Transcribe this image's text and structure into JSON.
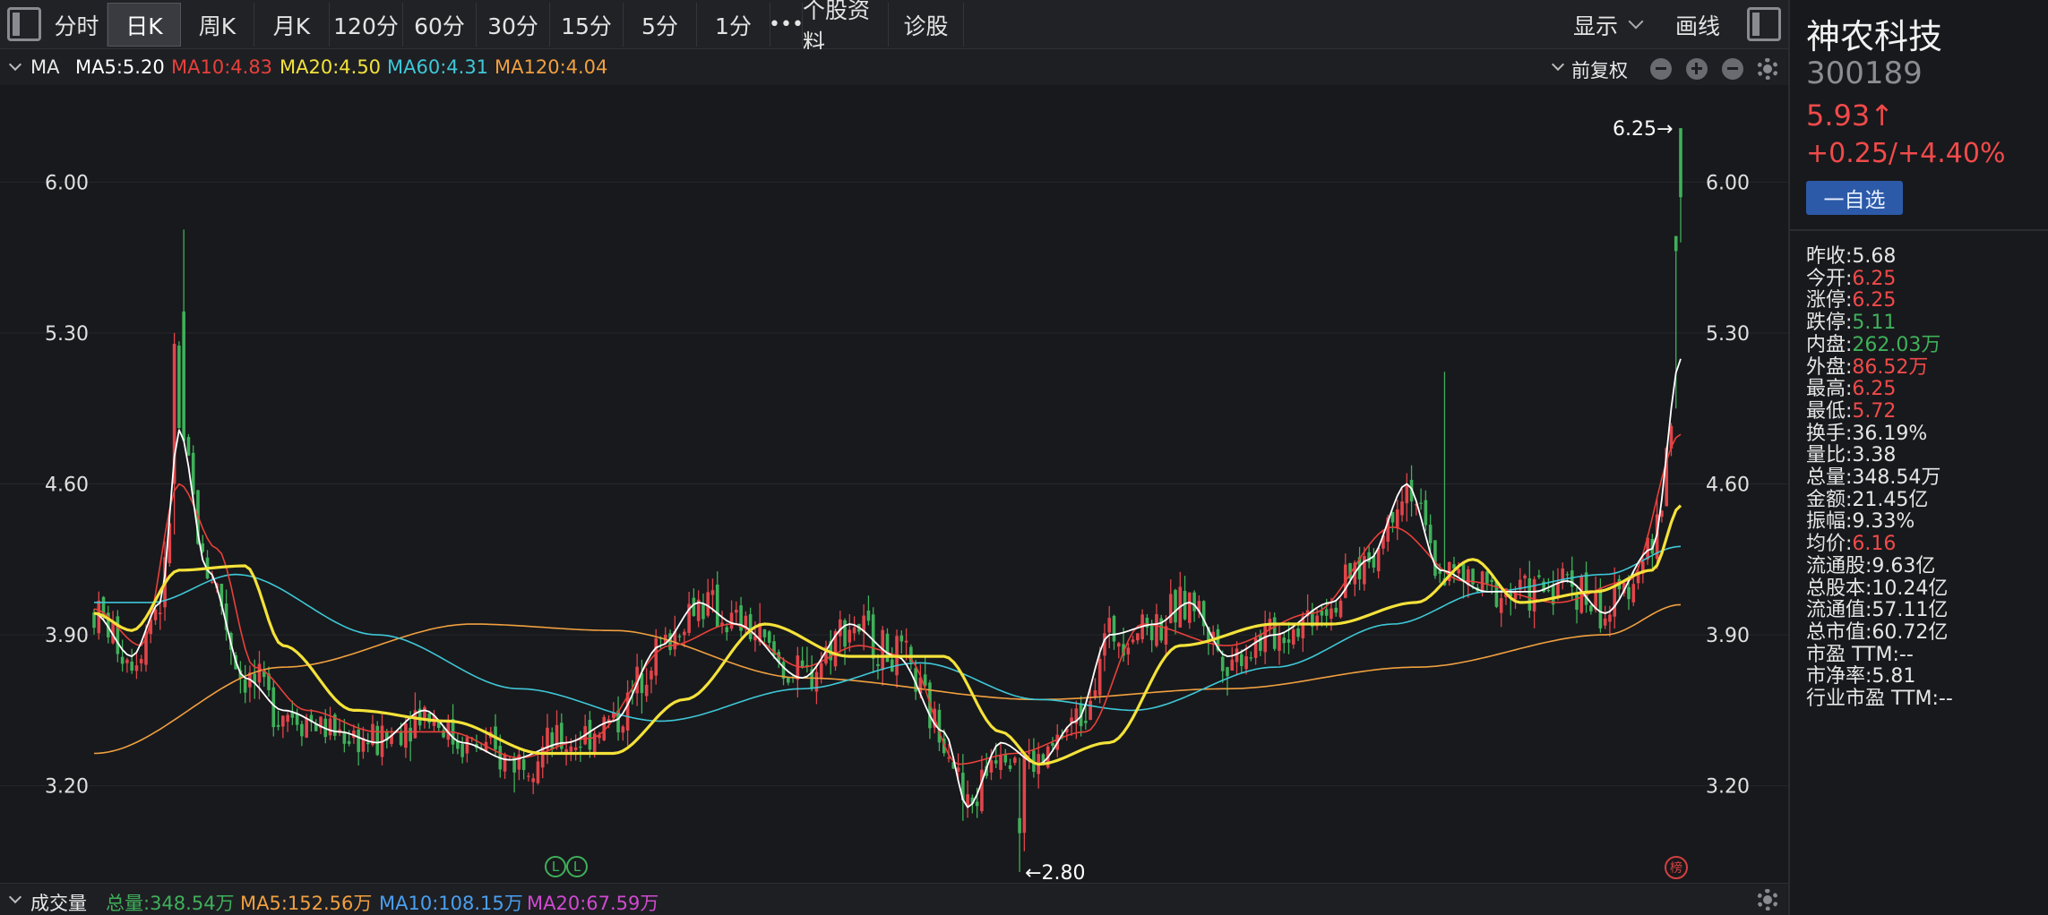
{
  "tabs": [
    {
      "label": "分时",
      "active": false
    },
    {
      "label": "日K",
      "active": true
    },
    {
      "label": "周K",
      "active": false
    },
    {
      "label": "月K",
      "active": false
    },
    {
      "label": "120分",
      "active": false
    },
    {
      "label": "60分",
      "active": false
    },
    {
      "label": "30分",
      "active": false
    },
    {
      "label": "15分",
      "active": false
    },
    {
      "label": "5分",
      "active": false
    },
    {
      "label": "1分",
      "active": false
    },
    {
      "label": "•••",
      "active": false
    },
    {
      "label": "个股资料",
      "active": false
    },
    {
      "label": "诊股",
      "active": false
    }
  ],
  "toolbar": {
    "show_label": "显示",
    "draw_label": "画线"
  },
  "ma_bar": {
    "title": "MA",
    "ma5": "MA5:5.20",
    "ma10": "MA10:4.83",
    "ma20": "MA20:4.50",
    "ma60": "MA60:4.31",
    "ma120": "MA120:4.04",
    "adjust": "前复权"
  },
  "volume_bar": {
    "title": "成交量",
    "total": "总量:348.54万",
    "ma5": "MA5:152.56万",
    "ma10": "MA10:108.15万",
    "ma20": "MA20:67.59万"
  },
  "badges": {
    "l": "L",
    "bang": "榜"
  },
  "colors": {
    "up": "#e0454a",
    "down": "#3fb05a",
    "ma5": "#ffffff",
    "ma10": "#e8403a",
    "ma20": "#f4e23a",
    "ma60": "#3ec8d8",
    "ma120": "#f0a040",
    "vol_total": "#3fb05a",
    "vol_ma5": "#f0a040",
    "vol_ma10": "#4aa0f0",
    "vol_ma20": "#d04ad0"
  },
  "stock": {
    "name": "神农科技",
    "code": "300189",
    "price": "5.93↑",
    "change": "+0.25/+4.40%",
    "watch_label": "一自选"
  },
  "stats": [
    {
      "label": "昨收:",
      "value": "5.68",
      "color": "#e6e6e6"
    },
    {
      "label": "今开:",
      "value": "6.25",
      "color": "#f04a4a"
    },
    {
      "label": "涨停:",
      "value": "6.25",
      "color": "#f04a4a"
    },
    {
      "label": "跌停:",
      "value": "5.11",
      "color": "#3fb05a"
    },
    {
      "label": "内盘:",
      "value": "262.03万",
      "color": "#3fb05a"
    },
    {
      "label": "外盘:",
      "value": "86.52万",
      "color": "#f04a4a"
    },
    {
      "label": "最高:",
      "value": "6.25",
      "color": "#f04a4a"
    },
    {
      "label": "最低:",
      "value": "5.72",
      "color": "#f04a4a"
    },
    {
      "label": "换手:",
      "value": "36.19%",
      "color": "#e6e6e6"
    },
    {
      "label": "量比:",
      "value": "3.38",
      "color": "#e6e6e6"
    },
    {
      "label": "总量:",
      "value": "348.54万",
      "color": "#e6e6e6"
    },
    {
      "label": "金额:",
      "value": "21.45亿",
      "color": "#e6e6e6"
    },
    {
      "label": "振幅:",
      "value": "9.33%",
      "color": "#e6e6e6"
    },
    {
      "label": "均价:",
      "value": "6.16",
      "color": "#f04a4a"
    },
    {
      "label": "流通股:",
      "value": "9.63亿",
      "color": "#e6e6e6"
    },
    {
      "label": "总股本:",
      "value": "10.24亿",
      "color": "#e6e6e6"
    },
    {
      "label": "流通值:",
      "value": "57.11亿",
      "color": "#e6e6e6"
    },
    {
      "label": "总市值:",
      "value": "60.72亿",
      "color": "#e6e6e6"
    },
    {
      "label": "市盈 TTM:",
      "value": "--",
      "color": "#e6e6e6"
    },
    {
      "label": "市净率:",
      "value": "5.81",
      "color": "#e6e6e6"
    },
    {
      "label": "行业市盈 TTM:",
      "value": "--",
      "color": "#e6e6e6"
    }
  ],
  "chart_data": {
    "type": "candlestick",
    "y_ticks": [
      "6.00",
      "5.30",
      "4.60",
      "3.90",
      "3.20"
    ],
    "ylim": [
      2.75,
      6.45
    ],
    "high_marker": "6.25→",
    "low_marker": "←2.80",
    "high_value": 6.25,
    "low_value": 2.8,
    "ma_anchor_points": {
      "ma5": [
        [
          0,
          4.0
        ],
        [
          8,
          3.8
        ],
        [
          14,
          4.05
        ],
        [
          18,
          4.85
        ],
        [
          24,
          4.2
        ],
        [
          32,
          3.7
        ],
        [
          40,
          3.55
        ],
        [
          52,
          3.45
        ],
        [
          60,
          3.4
        ],
        [
          70,
          3.55
        ],
        [
          78,
          3.4
        ],
        [
          88,
          3.32
        ],
        [
          100,
          3.4
        ],
        [
          110,
          3.5
        ],
        [
          120,
          3.85
        ],
        [
          128,
          4.05
        ],
        [
          136,
          3.95
        ],
        [
          150,
          3.7
        ],
        [
          160,
          3.95
        ],
        [
          170,
          3.8
        ],
        [
          180,
          3.45
        ],
        [
          185,
          3.1
        ],
        [
          192,
          3.4
        ],
        [
          200,
          3.3
        ],
        [
          208,
          3.5
        ],
        [
          215,
          3.9
        ],
        [
          225,
          3.95
        ],
        [
          232,
          4.05
        ],
        [
          240,
          3.8
        ],
        [
          250,
          3.9
        ],
        [
          262,
          4.05
        ],
        [
          270,
          4.25
        ],
        [
          278,
          4.6
        ],
        [
          285,
          4.2
        ],
        [
          295,
          4.1
        ],
        [
          305,
          4.1
        ],
        [
          312,
          4.15
        ],
        [
          320,
          4.0
        ],
        [
          330,
          4.3
        ],
        [
          336,
          5.18
        ]
      ],
      "ma10": [
        [
          0,
          4.02
        ],
        [
          10,
          3.85
        ],
        [
          18,
          4.6
        ],
        [
          26,
          4.3
        ],
        [
          34,
          3.75
        ],
        [
          45,
          3.55
        ],
        [
          60,
          3.45
        ],
        [
          75,
          3.45
        ],
        [
          90,
          3.33
        ],
        [
          105,
          3.42
        ],
        [
          122,
          3.85
        ],
        [
          135,
          3.95
        ],
        [
          150,
          3.75
        ],
        [
          162,
          3.85
        ],
        [
          172,
          3.8
        ],
        [
          183,
          3.3
        ],
        [
          195,
          3.35
        ],
        [
          210,
          3.45
        ],
        [
          222,
          3.95
        ],
        [
          240,
          3.85
        ],
        [
          258,
          4.0
        ],
        [
          275,
          4.4
        ],
        [
          290,
          4.15
        ],
        [
          310,
          4.05
        ],
        [
          325,
          4.15
        ],
        [
          336,
          4.83
        ]
      ],
      "ma20": [
        [
          0,
          4.0
        ],
        [
          8,
          3.92
        ],
        [
          18,
          4.2
        ],
        [
          32,
          4.22
        ],
        [
          40,
          3.85
        ],
        [
          55,
          3.55
        ],
        [
          75,
          3.5
        ],
        [
          95,
          3.35
        ],
        [
          110,
          3.35
        ],
        [
          125,
          3.6
        ],
        [
          142,
          3.95
        ],
        [
          160,
          3.8
        ],
        [
          180,
          3.8
        ],
        [
          192,
          3.45
        ],
        [
          200,
          3.3
        ],
        [
          215,
          3.4
        ],
        [
          230,
          3.85
        ],
        [
          250,
          3.95
        ],
        [
          262,
          3.95
        ],
        [
          280,
          4.05
        ],
        [
          292,
          4.25
        ],
        [
          302,
          4.05
        ],
        [
          318,
          4.1
        ],
        [
          330,
          4.2
        ],
        [
          336,
          4.5
        ]
      ],
      "ma60": [
        [
          0,
          4.05
        ],
        [
          12,
          4.05
        ],
        [
          30,
          4.18
        ],
        [
          60,
          3.9
        ],
        [
          90,
          3.65
        ],
        [
          120,
          3.5
        ],
        [
          150,
          3.65
        ],
        [
          175,
          3.77
        ],
        [
          200,
          3.6
        ],
        [
          220,
          3.55
        ],
        [
          250,
          3.75
        ],
        [
          275,
          3.95
        ],
        [
          295,
          4.1
        ],
        [
          320,
          4.18
        ],
        [
          336,
          4.31
        ]
      ],
      "ma120": [
        [
          0,
          3.35
        ],
        [
          40,
          3.75
        ],
        [
          80,
          3.95
        ],
        [
          110,
          3.92
        ],
        [
          150,
          3.7
        ],
        [
          200,
          3.6
        ],
        [
          240,
          3.65
        ],
        [
          280,
          3.75
        ],
        [
          320,
          3.9
        ],
        [
          336,
          4.04
        ]
      ]
    },
    "volume": {
      "total": "348.54万",
      "ma5": "152.56万",
      "ma10": "108.15万",
      "ma20": "67.59万"
    }
  }
}
